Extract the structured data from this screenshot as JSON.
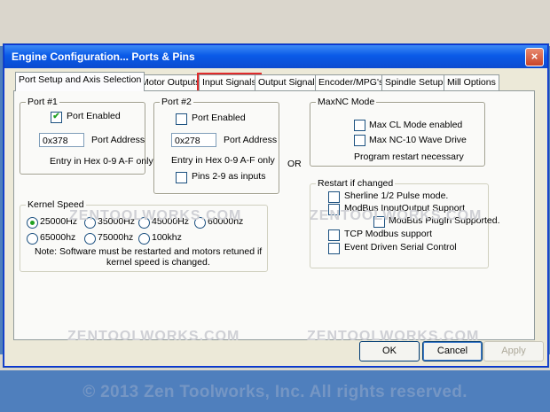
{
  "dialog": {
    "title": "Engine Configuration... Ports & Pins",
    "close_label": "×"
  },
  "tabs": [
    "Port Setup and Axis Selection",
    "Motor Outputs",
    "Input Signals",
    "Output Signals",
    "Encoder/MPG's",
    "Spindle Setup",
    "Mill Options"
  ],
  "port1": {
    "legend": "Port #1",
    "enabled_label": "Port Enabled",
    "enabled": true,
    "address_value": "0x378",
    "address_label": "Port Address",
    "hint": "Entry in Hex 0-9 A-F only"
  },
  "port2": {
    "legend": "Port #2",
    "enabled_label": "Port Enabled",
    "enabled": false,
    "address_value": "0x278",
    "address_label": "Port Address",
    "hint": "Entry in Hex 0-9 A-F only",
    "pins_label": "Pins 2-9 as inputs"
  },
  "or_label": "OR",
  "maxnc": {
    "legend": "MaxNC Mode",
    "cl_label": "Max CL Mode enabled",
    "wave_label": "Max NC-10 Wave Drive",
    "restart_note": "Program restart necessary"
  },
  "restart": {
    "legend": "Restart if changed",
    "items": [
      "Sherline 1/2 Pulse mode.",
      "ModBus InputOutput Support",
      "ModBus PlugIn Supported.",
      "TCP Modbus support",
      "Event Driven Serial Control"
    ]
  },
  "kernel": {
    "legend": "Kernel Speed",
    "options": [
      "25000Hz",
      "35000Hz",
      "45000Hz",
      "60000hz",
      "65000hz",
      "75000hz",
      "100khz"
    ],
    "selected": "25000Hz",
    "note_line1": "Note: Software must be restarted and motors retuned if",
    "note_line2": "kernel speed is changed."
  },
  "watermark": "ZENTOOLWORKS.COM",
  "buttons": {
    "ok": "OK",
    "cancel": "Cancel",
    "apply": "Apply"
  },
  "copyright": "© 2013 Zen Toolworks, Inc. All rights reserved."
}
